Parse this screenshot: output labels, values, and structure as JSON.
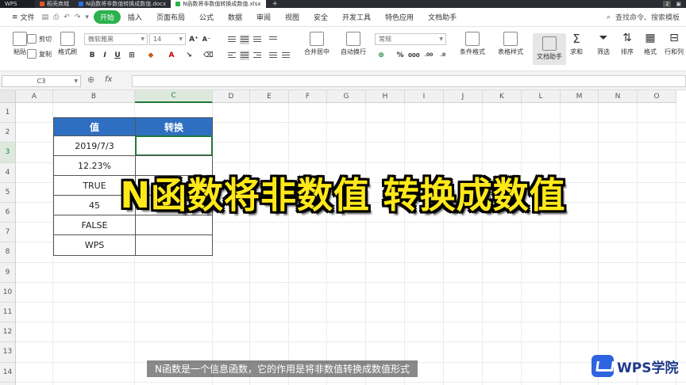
{
  "titlebar": {
    "app_tab": "WPS",
    "tabs": [
      {
        "label": "稻壳商城",
        "color": "#e0572a"
      },
      {
        "label": "N函数将非数值转换成数值.docx",
        "color": "#2f6ee0"
      },
      {
        "label": "N函数将非数值转换成数值.xlsx",
        "color": "#2bb24c"
      }
    ],
    "badge": "2"
  },
  "menubar": {
    "file": "文件",
    "items": [
      "开始",
      "插入",
      "页面布局",
      "公式",
      "数据",
      "审阅",
      "视图",
      "安全",
      "开发工具",
      "特色应用",
      "文档助手"
    ],
    "active": "开始",
    "search": "查找命令、搜索模板"
  },
  "ribbon": {
    "paste": "粘贴",
    "cut": "剪切",
    "copy": "复制",
    "format_painter": "格式刷",
    "font_name": "微软雅黑",
    "font_size": "14",
    "merge_center": "合并居中",
    "wrap_text": "自动换行",
    "number_format": "常规",
    "conditional_format": "条件格式",
    "table_style": "表格样式",
    "doc_helper": "文档助手",
    "sum": "求和",
    "filter": "筛选",
    "sort": "排序",
    "format": "格式",
    "rows_cols": "行和列"
  },
  "formulabar": {
    "name_box": "C3",
    "fx": "fx",
    "formula": ""
  },
  "grid": {
    "columns": [
      "A",
      "B",
      "C",
      "D",
      "E",
      "F",
      "G",
      "H",
      "I",
      "J",
      "K",
      "L",
      "M",
      "N",
      "O"
    ],
    "active_column": "C",
    "rows": [
      "1",
      "2",
      "3",
      "4",
      "5",
      "6",
      "7",
      "8",
      "9",
      "10",
      "11",
      "12",
      "13",
      "14",
      "15"
    ],
    "active_row": "3"
  },
  "table": {
    "header_value": "值",
    "header_convert": "转换",
    "values": [
      "2019/7/3",
      "12.23%",
      "TRUE",
      "45",
      "FALSE",
      "WPS"
    ]
  },
  "overlay": {
    "title": "N函数将非数值 转换成数值"
  },
  "subtitle": "N函数是一个信息函数，它的作用是将非数值转换成数值形式",
  "logo": {
    "text": "WPS学院"
  },
  "colors": {
    "accent_green": "#2bb24c",
    "table_header_blue": "#2f6fc2",
    "overlay_yellow": "#ffe81a",
    "logo_blue": "#2f64e0"
  }
}
